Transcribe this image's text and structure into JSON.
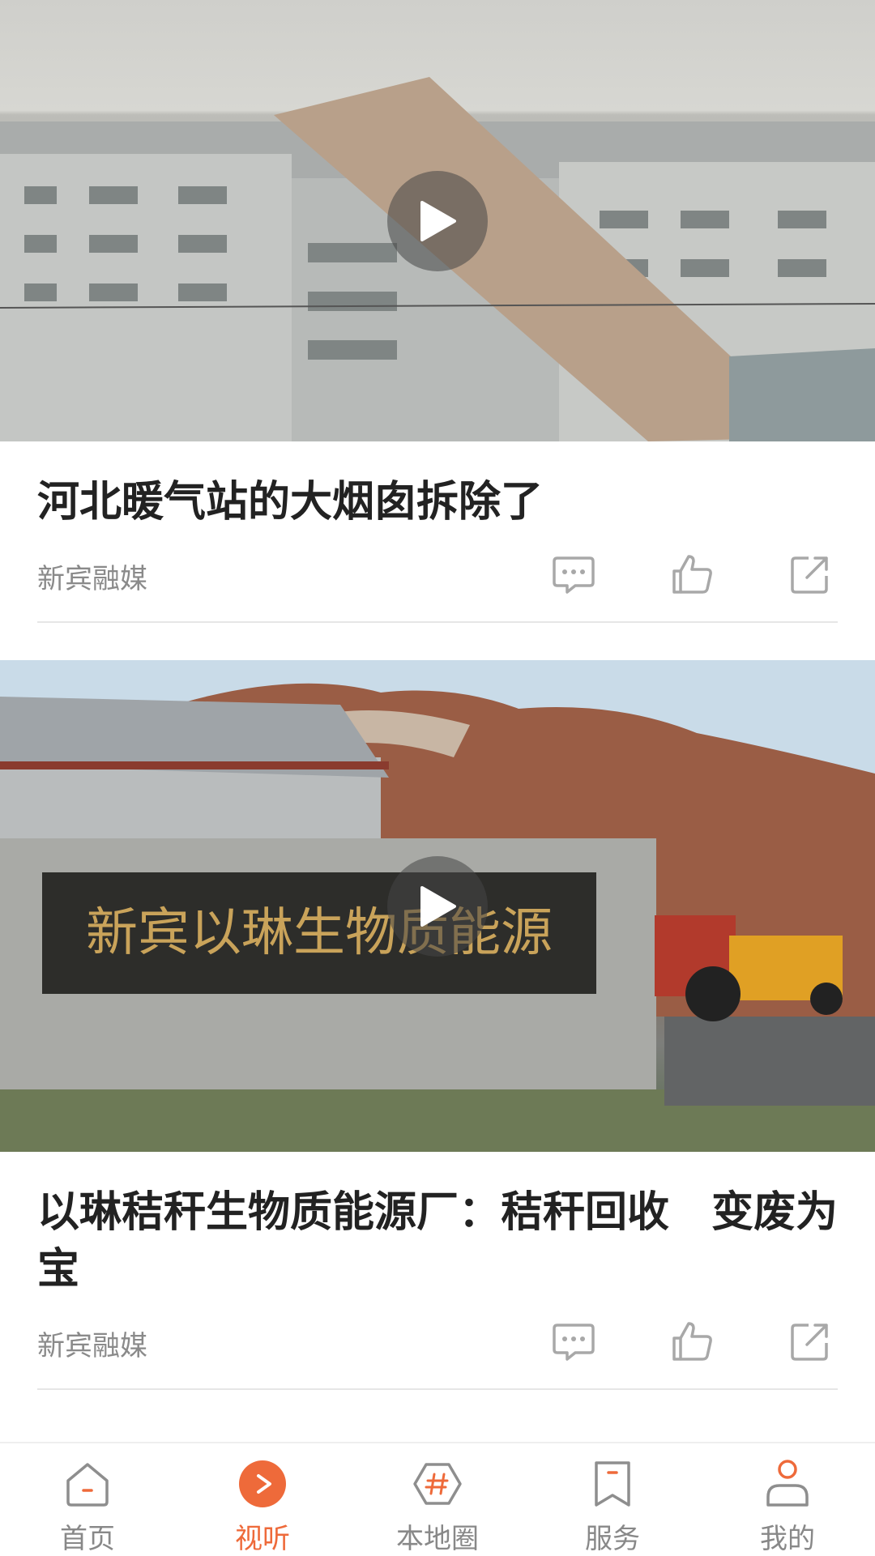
{
  "feed": {
    "items": [
      {
        "title": "河北暖气站的大烟囱拆除了",
        "source": "新宾融媒"
      },
      {
        "title": "以琳秸秆生物质能源厂：秸秆回收　变废为宝",
        "source": "新宾融媒",
        "thumbnail_sign_text": "新宾以琳生物质能源"
      }
    ]
  },
  "tabbar": {
    "active_color": "#ee6a3a",
    "items": [
      {
        "label": "首页",
        "icon": "home-icon"
      },
      {
        "label": "视听",
        "icon": "play-circle-icon"
      },
      {
        "label": "本地圈",
        "icon": "hashtag-hexagon-icon"
      },
      {
        "label": "服务",
        "icon": "bookmark-icon"
      },
      {
        "label": "我的",
        "icon": "profile-icon"
      }
    ]
  }
}
